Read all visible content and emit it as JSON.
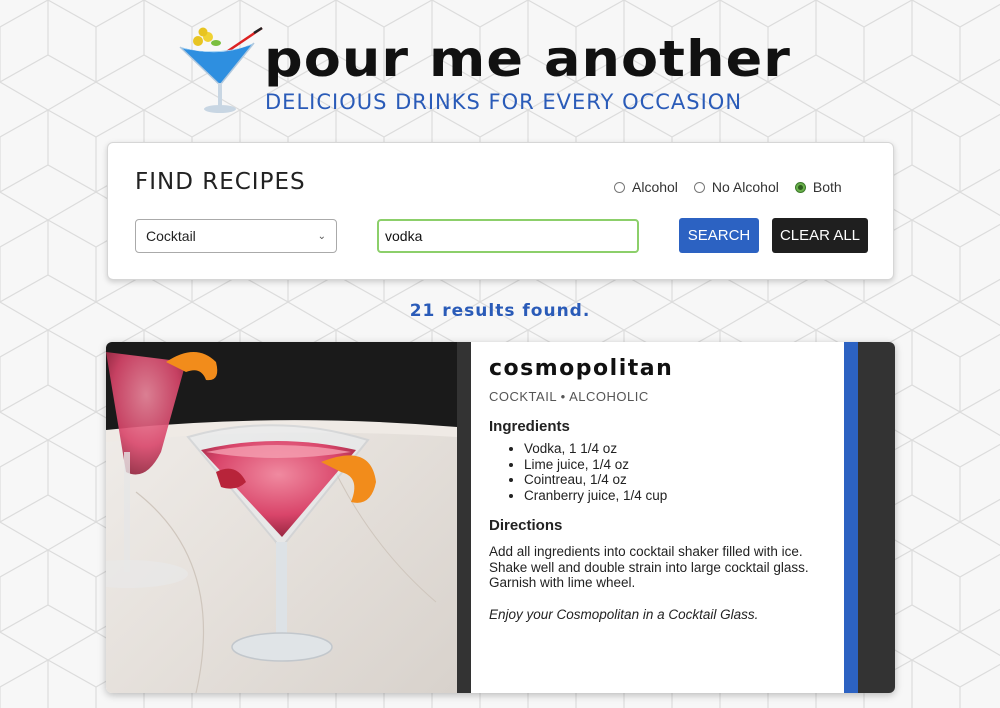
{
  "header": {
    "title": "pour me another",
    "tagline": "DELICIOUS DRINKS FOR EVERY OCCASION"
  },
  "search": {
    "heading": "FIND RECIPES",
    "radio_options": [
      {
        "label": "Alcohol",
        "checked": false
      },
      {
        "label": "No Alcohol",
        "checked": false
      },
      {
        "label": "Both",
        "checked": true
      }
    ],
    "type_select_value": "Cocktail",
    "query_value": "vodka",
    "search_button": "SEARCH",
    "clear_button": "CLEAR ALL"
  },
  "results": {
    "count_text": "21 results found."
  },
  "recipe": {
    "name": "cosmopolitan",
    "meta": "COCKTAIL • ALCOHOLIC",
    "ingredients_heading": "Ingredients",
    "ingredients": [
      "Vodka, 1 1/4 oz",
      "Lime juice, 1/4 oz",
      "Cointreau, 1/4 oz",
      "Cranberry juice, 1/4 cup"
    ],
    "directions_heading": "Directions",
    "directions": "Add all ingredients into cocktail shaker filled with ice. Shake well and double strain into large cocktail glass. Garnish with lime wheel.",
    "enjoy": "Enjoy your Cosmopolitan in a Cocktail Glass."
  },
  "colors": {
    "brand_blue": "#2c62c2",
    "dark": "#1f1f1f",
    "radio_checked": "#6ab04c",
    "input_focus": "#8ccf6a"
  },
  "icons": {
    "logo": "cocktail-glass-icon",
    "select_chevron": "chevron-down-icon"
  }
}
